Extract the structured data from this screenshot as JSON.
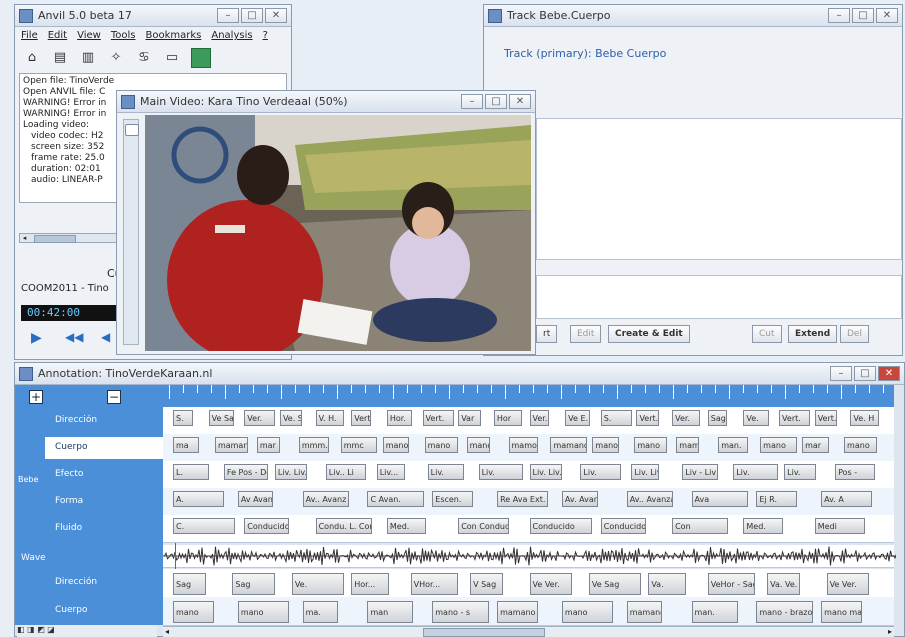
{
  "anvil_window": {
    "title": "Anvil 5.0 beta 17",
    "menu": [
      "File",
      "Edit",
      "View",
      "Tools",
      "Bookmarks",
      "Analysis",
      "?"
    ],
    "log_lines": [
      "Open file: TinoVerde",
      "Open ANVIL file: C",
      "WARNING! Error in",
      "WARNING! Error in",
      "Loading video:",
      "  video codec: H2",
      "  screen size: 352",
      "  frame rate: 25.0",
      "  duration: 02:01",
      "  audio: LINEAR-P"
    ],
    "cursor_label": "Cur",
    "file_name": "COOM2011 - Tino",
    "timecode": "00:42:00"
  },
  "video_window": {
    "title": "Main Video: Kara Tino Verdeaal (50%)"
  },
  "track_window": {
    "title": "Track Bebe.Cuerpo",
    "track_label": "Track (primary): Bebe Cuerpo",
    "buttons": {
      "new": "rt",
      "edit": "Edit",
      "create_edit": "Create & Edit",
      "cut": "Cut",
      "extend": "Extend",
      "del": "Del"
    }
  },
  "annotation_window": {
    "title": "Annotation: TinoVerdeKaraan.nl",
    "tracks": [
      {
        "label": "Dirección",
        "elements": [
          {
            "t": "S."
          },
          {
            "t": "Ve Sag"
          },
          {
            "t": "Ver."
          },
          {
            "t": "Ve. Se. H."
          },
          {
            "t": "V. H."
          },
          {
            "t": "Vert."
          },
          {
            "t": "Hor."
          },
          {
            "t": "Vert."
          },
          {
            "t": "Var"
          },
          {
            "t": "Hor"
          },
          {
            "t": "Ver."
          },
          {
            "t": "Ve E."
          },
          {
            "t": "S."
          },
          {
            "t": "Vert."
          },
          {
            "t": "Ver."
          },
          {
            "t": "Sag"
          },
          {
            "t": "Ve."
          },
          {
            "t": "Vert."
          },
          {
            "t": "Vert."
          },
          {
            "t": "Ve. H"
          }
        ]
      },
      {
        "label": "Cuerpo",
        "elements": [
          {
            "t": "ma"
          },
          {
            "t": "mamano"
          },
          {
            "t": "mar"
          },
          {
            "t": "mmm."
          },
          {
            "t": "mmc"
          },
          {
            "t": "mano"
          },
          {
            "t": "mano"
          },
          {
            "t": "mano"
          },
          {
            "t": "mamo"
          },
          {
            "t": "mamano"
          },
          {
            "t": "mano"
          },
          {
            "t": "mano"
          },
          {
            "t": "mamano"
          },
          {
            "t": "man."
          },
          {
            "t": "mano"
          },
          {
            "t": "mar"
          },
          {
            "t": "mano"
          }
        ]
      },
      {
        "label": "Efecto",
        "elements": [
          {
            "t": "L."
          },
          {
            "t": "Fe Pos - Des"
          },
          {
            "t": "Liv. Liv. Li..."
          },
          {
            "t": "Liv.. Li"
          },
          {
            "t": "Liv..."
          },
          {
            "t": "Liv."
          },
          {
            "t": "Liv."
          },
          {
            "t": "Liv. Liv."
          },
          {
            "t": "Liv."
          },
          {
            "t": "Liv. Liv. Liv."
          },
          {
            "t": "Liv - Liv - Di."
          },
          {
            "t": "Liv."
          },
          {
            "t": "Liv."
          },
          {
            "t": "Pos -"
          }
        ]
      },
      {
        "label": "Forma",
        "elements": [
          {
            "t": "A."
          },
          {
            "t": "Av Avanz Fel"
          },
          {
            "t": "Av.. Avanz Fe"
          },
          {
            "t": "C Avan."
          },
          {
            "t": "Escen."
          },
          {
            "t": "Re Ava Ext. Ret."
          },
          {
            "t": "Av. Avanz Ret."
          },
          {
            "t": "Av.. Avanzar Re"
          },
          {
            "t": "Ava"
          },
          {
            "t": "Ej R."
          },
          {
            "t": "Av. A"
          }
        ]
      },
      {
        "label": "Fluido",
        "elements": [
          {
            "t": "C."
          },
          {
            "t": "Conducido"
          },
          {
            "t": "Condu. L. Conducido"
          },
          {
            "t": "Med."
          },
          {
            "t": "Con Conducido"
          },
          {
            "t": "Conducido"
          },
          {
            "t": "Conducido"
          },
          {
            "t": "Con"
          },
          {
            "t": "Med."
          },
          {
            "t": "Medi"
          }
        ]
      }
    ],
    "group_label": "Bebe",
    "wave_label": "Wave",
    "lower_tracks": [
      {
        "label": "Dirección",
        "elements": [
          {
            "t": "Sag"
          },
          {
            "t": "Sag"
          },
          {
            "t": "Ve."
          },
          {
            "t": "Hor..."
          },
          {
            "t": "VHor..."
          },
          {
            "t": "V Sag"
          },
          {
            "t": "Ve Ver."
          },
          {
            "t": "Ve Sag"
          },
          {
            "t": "Va."
          },
          {
            "t": "VeHor - Sag"
          },
          {
            "t": "Va. Ve."
          },
          {
            "t": "Ve Ver."
          }
        ]
      },
      {
        "label": "Cuerpo",
        "elements": [
          {
            "t": "mano"
          },
          {
            "t": "mano"
          },
          {
            "t": "ma."
          },
          {
            "t": "man"
          },
          {
            "t": "mano - s"
          },
          {
            "t": "mamano"
          },
          {
            "t": "mano"
          },
          {
            "t": "mamano"
          },
          {
            "t": "man."
          },
          {
            "t": "mano - brazo"
          },
          {
            "t": "mano mano - br."
          }
        ]
      }
    ]
  }
}
